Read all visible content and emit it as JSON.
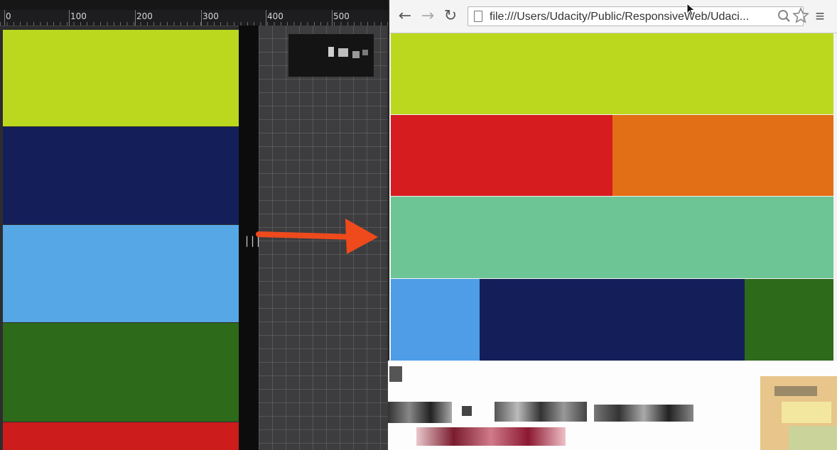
{
  "ruler": {
    "labels": [
      "0",
      "100",
      "200",
      "300",
      "400",
      "500"
    ]
  },
  "emulator": {
    "resize_handle_glyph": "|||",
    "stacked_boxes": [
      {
        "color": "#bcd81e"
      },
      {
        "color": "#141f5a"
      },
      {
        "color": "#56a7e5"
      },
      {
        "color": "#2d6a1a"
      },
      {
        "color": "#cc1c1c"
      }
    ]
  },
  "arrow": {
    "color": "#ee4a1c"
  },
  "browser": {
    "back_glyph": "←",
    "forward_glyph": "→",
    "reload_glyph": "↻",
    "url": "file:///Users/Udacity/Public/ResponsiveWeb/Udaci...",
    "menu_glyph": "≡",
    "rows": [
      {
        "boxes": [
          {
            "color": "#bcd81e"
          }
        ]
      },
      {
        "boxes": [
          {
            "color": "#d61c1f"
          },
          {
            "color": "#e26e15"
          }
        ]
      },
      {
        "boxes": [
          {
            "color": "#6dc596"
          }
        ]
      },
      {
        "boxes": [
          {
            "color": "#4e9de6"
          },
          {
            "color": "#141f5a"
          },
          {
            "color": "#2d6a1a"
          }
        ]
      }
    ]
  }
}
